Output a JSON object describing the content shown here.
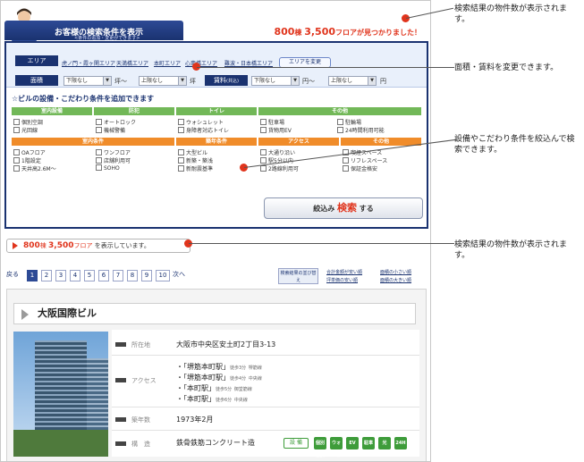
{
  "header": {
    "title": "お客様の検索条件を表示",
    "subtitle": "<条件の追加・変更ができます>",
    "count_num": "800",
    "count_unit1": "棟",
    "count_num2": "3,500",
    "count_tail": "フロアが見つかりました！"
  },
  "area": {
    "label": "エリア",
    "links": [
      "虎ノ門・霞ヶ関エリア",
      "天満橋エリア",
      "本町エリア",
      "心斎橋エリア",
      "難波・日本橋エリア"
    ],
    "change_button": "エリアを変更"
  },
  "size": {
    "label": "面積",
    "lower": "下限なし",
    "upper": "上限なし",
    "unit_from": "坪～",
    "unit_to": "坪",
    "rent_label": "賃料",
    "rent_sub": "(共込)",
    "rent_lower": "下限なし",
    "rent_upper": "上限なし",
    "rent_unit_from": "円～",
    "rent_unit_to": "円"
  },
  "facilities": {
    "title": "ビルの設備・こだわり条件を追加できます",
    "groups": [
      {
        "name": "室内設備",
        "items": [
          "個別空調",
          "光回線"
        ]
      },
      {
        "name": "防犯",
        "items": [
          "オートロック",
          "機械警備"
        ]
      },
      {
        "name": "トイレ",
        "items": [
          "ウォシュレット",
          "身障者対応トイレ"
        ]
      },
      {
        "name": "その他",
        "items": [
          "駐車場",
          "駐輪場",
          "貨物用EV",
          "24時間利用可能"
        ]
      }
    ],
    "groups2": [
      {
        "name": "室内条件",
        "items": [
          "OAフロア",
          "ワンフロア",
          "1階設定",
          "店舗利用可",
          "天井高2.6M～",
          "SOHO"
        ]
      },
      {
        "name": "築年条件",
        "items": [
          "大型ビル",
          "新築・築浅",
          "新耐震基準"
        ]
      },
      {
        "name": "アクセス",
        "items": [
          "大通り沿い",
          "駅5分以内",
          "2路線利用可"
        ]
      },
      {
        "name": "その他",
        "items": [
          "喫煙スペース",
          "リフレスペース",
          "保証金格安"
        ]
      }
    ],
    "search_button_pre": "絞込み",
    "search_button_kw": "検索",
    "search_button_post": "する"
  },
  "result_bar": {
    "num": "800",
    "unit1": "棟",
    "num2": "3,500",
    "unit2": "フロア",
    "tail": "を表示しています。"
  },
  "pager": {
    "prev": "戻る",
    "pages": [
      "1",
      "2",
      "3",
      "4",
      "5",
      "6",
      "7",
      "8",
      "9",
      "10"
    ],
    "next": "次へ",
    "current": "1",
    "sort_box": "検索結果の並び替え",
    "sort_links": [
      "合計金額が安い順",
      "面積の小さい順",
      "坪単価の安い順",
      "面積の大きい順"
    ]
  },
  "building": {
    "name": "大阪国際ビル",
    "address_label": "所在地",
    "address": "大阪市中央区安土町2丁目3-13",
    "access_label": "アクセス",
    "access": [
      {
        "station": "・「堺筋本町駅」",
        "walk": "徒歩3分",
        "line": "堺筋線"
      },
      {
        "station": "・「堺筋本町駅」",
        "walk": "徒歩4分",
        "line": "中央線"
      },
      {
        "station": "・「本町駅」",
        "walk": "徒歩5分",
        "line": "御堂筋線"
      },
      {
        "station": "・「本町駅」",
        "walk": "徒歩6分",
        "line": "中央線"
      }
    ],
    "built_label": "築年数",
    "built": "1973年2月",
    "structure_label": "構　造",
    "structure": "鉄骨鉄筋コンクリート造",
    "icon_label": "設 備",
    "icons": [
      "個別空調",
      "ウォシュ",
      "EV",
      "駐車",
      "光",
      "24H"
    ]
  },
  "annotations": [
    "検索結果の物件数が表示されます。",
    "面積・賃料を変更できます。",
    "設備やこだわり条件を絞込んで検索できます。",
    "検索結果の物件数が表示されます。"
  ],
  "colors": {
    "navy": "#1a3270",
    "red": "#e0341c",
    "green": "#72b858",
    "orange": "#f08c2a"
  }
}
